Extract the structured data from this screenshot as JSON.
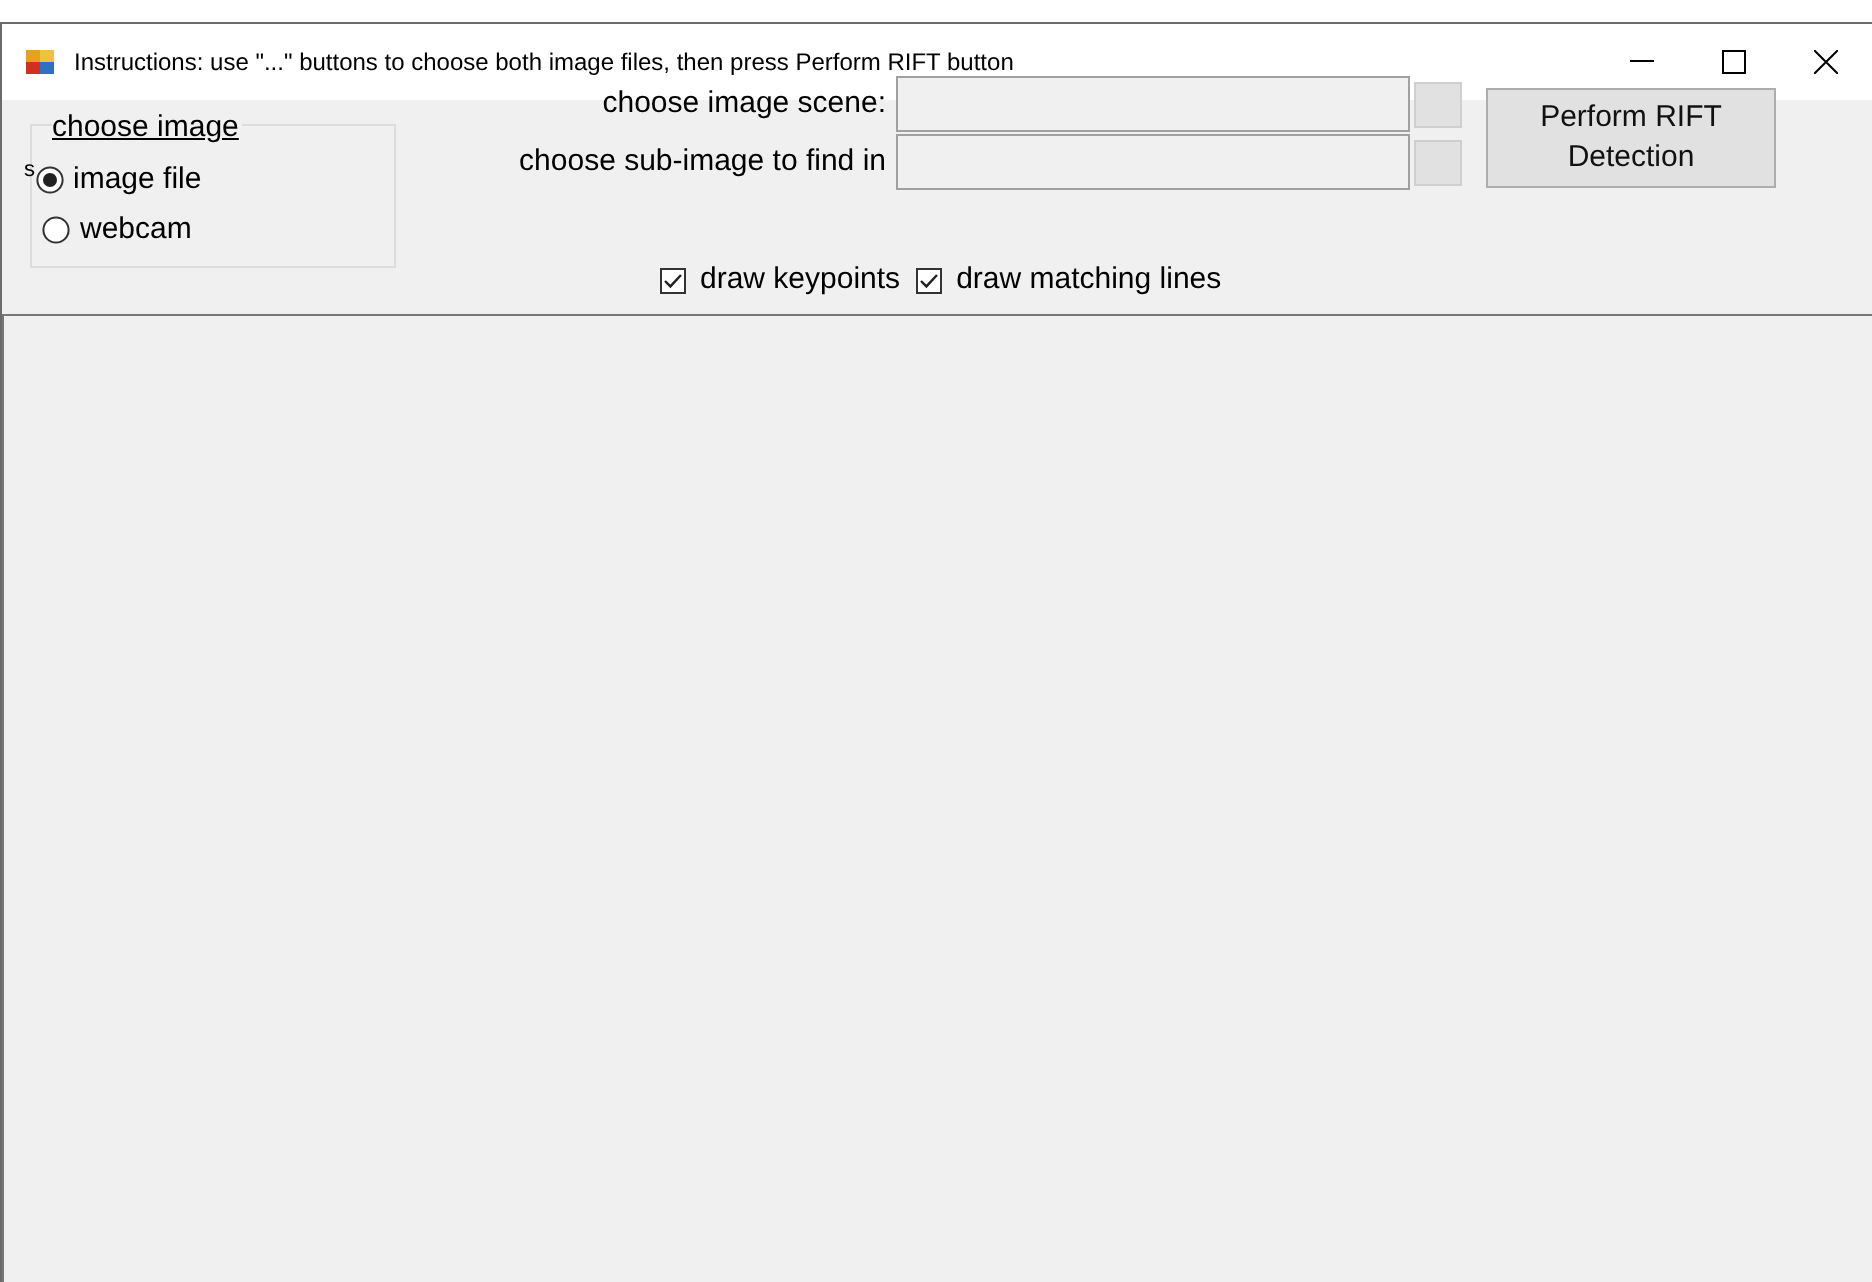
{
  "window": {
    "title": "Instructions: use \"...\" buttons to choose both image files, then press Perform RIFT button"
  },
  "source_group": {
    "title": "choose image",
    "clipped_text": "s",
    "options": [
      {
        "label": "image file",
        "selected": true
      },
      {
        "label": "webcam",
        "selected": false
      }
    ]
  },
  "file_fields": [
    {
      "label": "choose image scene:"
    },
    {
      "label": "choose sub-image to find in"
    }
  ],
  "perform_button": {
    "label": "Perform RIFT Detection"
  },
  "options": [
    {
      "label": "draw keypoints",
      "checked": true
    },
    {
      "label": "draw matching lines",
      "checked": true
    }
  ]
}
